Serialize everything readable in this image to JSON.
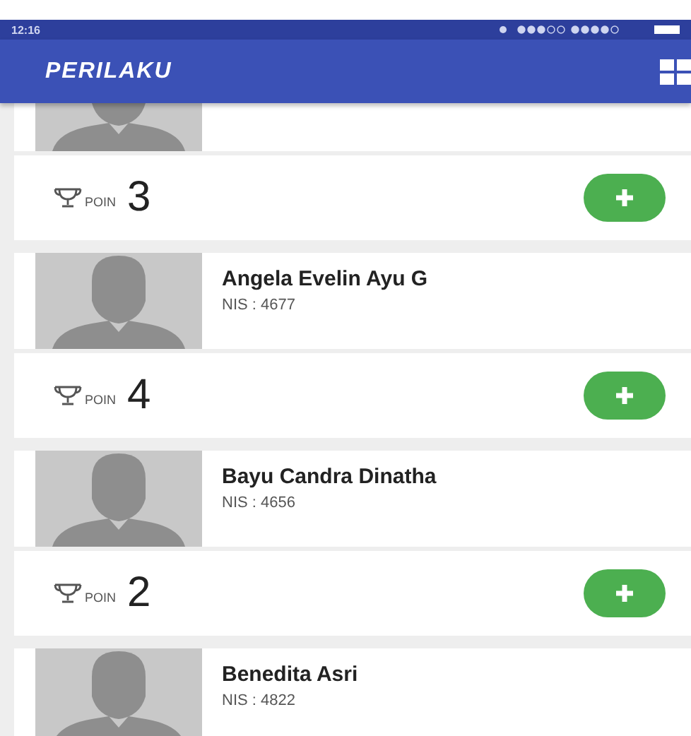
{
  "status_bar": {
    "time": "12:16"
  },
  "app_bar": {
    "title": "PERILAKU"
  },
  "students": [
    {
      "points_label": "POIN",
      "points": "3"
    },
    {
      "name": "Angela Evelin Ayu G",
      "nis": "NIS : 4677",
      "points_label": "POIN",
      "points": "4"
    },
    {
      "name": "Bayu Candra Dinatha",
      "nis": "NIS : 4656",
      "points_label": "POIN",
      "points": "2"
    },
    {
      "name": "Benedita Asri",
      "nis": "NIS : 4822"
    }
  ]
}
